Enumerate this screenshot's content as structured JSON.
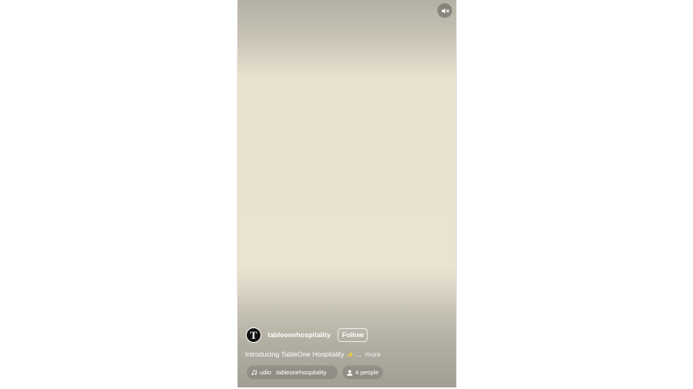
{
  "reel": {
    "mute_icon": "speaker-muted-icon",
    "author": {
      "avatar_letter": "T",
      "username": "tableonehospitality",
      "follow_label": "Follow"
    },
    "caption": {
      "text": "Introducing TableOne Hospitality",
      "emoji": "✨",
      "ellipsis": "...",
      "more_label": "more"
    },
    "audio": {
      "icon": "music-note-icon",
      "prefix": "udio",
      "artist": "tableonehospitality",
      "separator": "·"
    },
    "tagged": {
      "icon": "person-icon",
      "label": "4 people"
    }
  }
}
